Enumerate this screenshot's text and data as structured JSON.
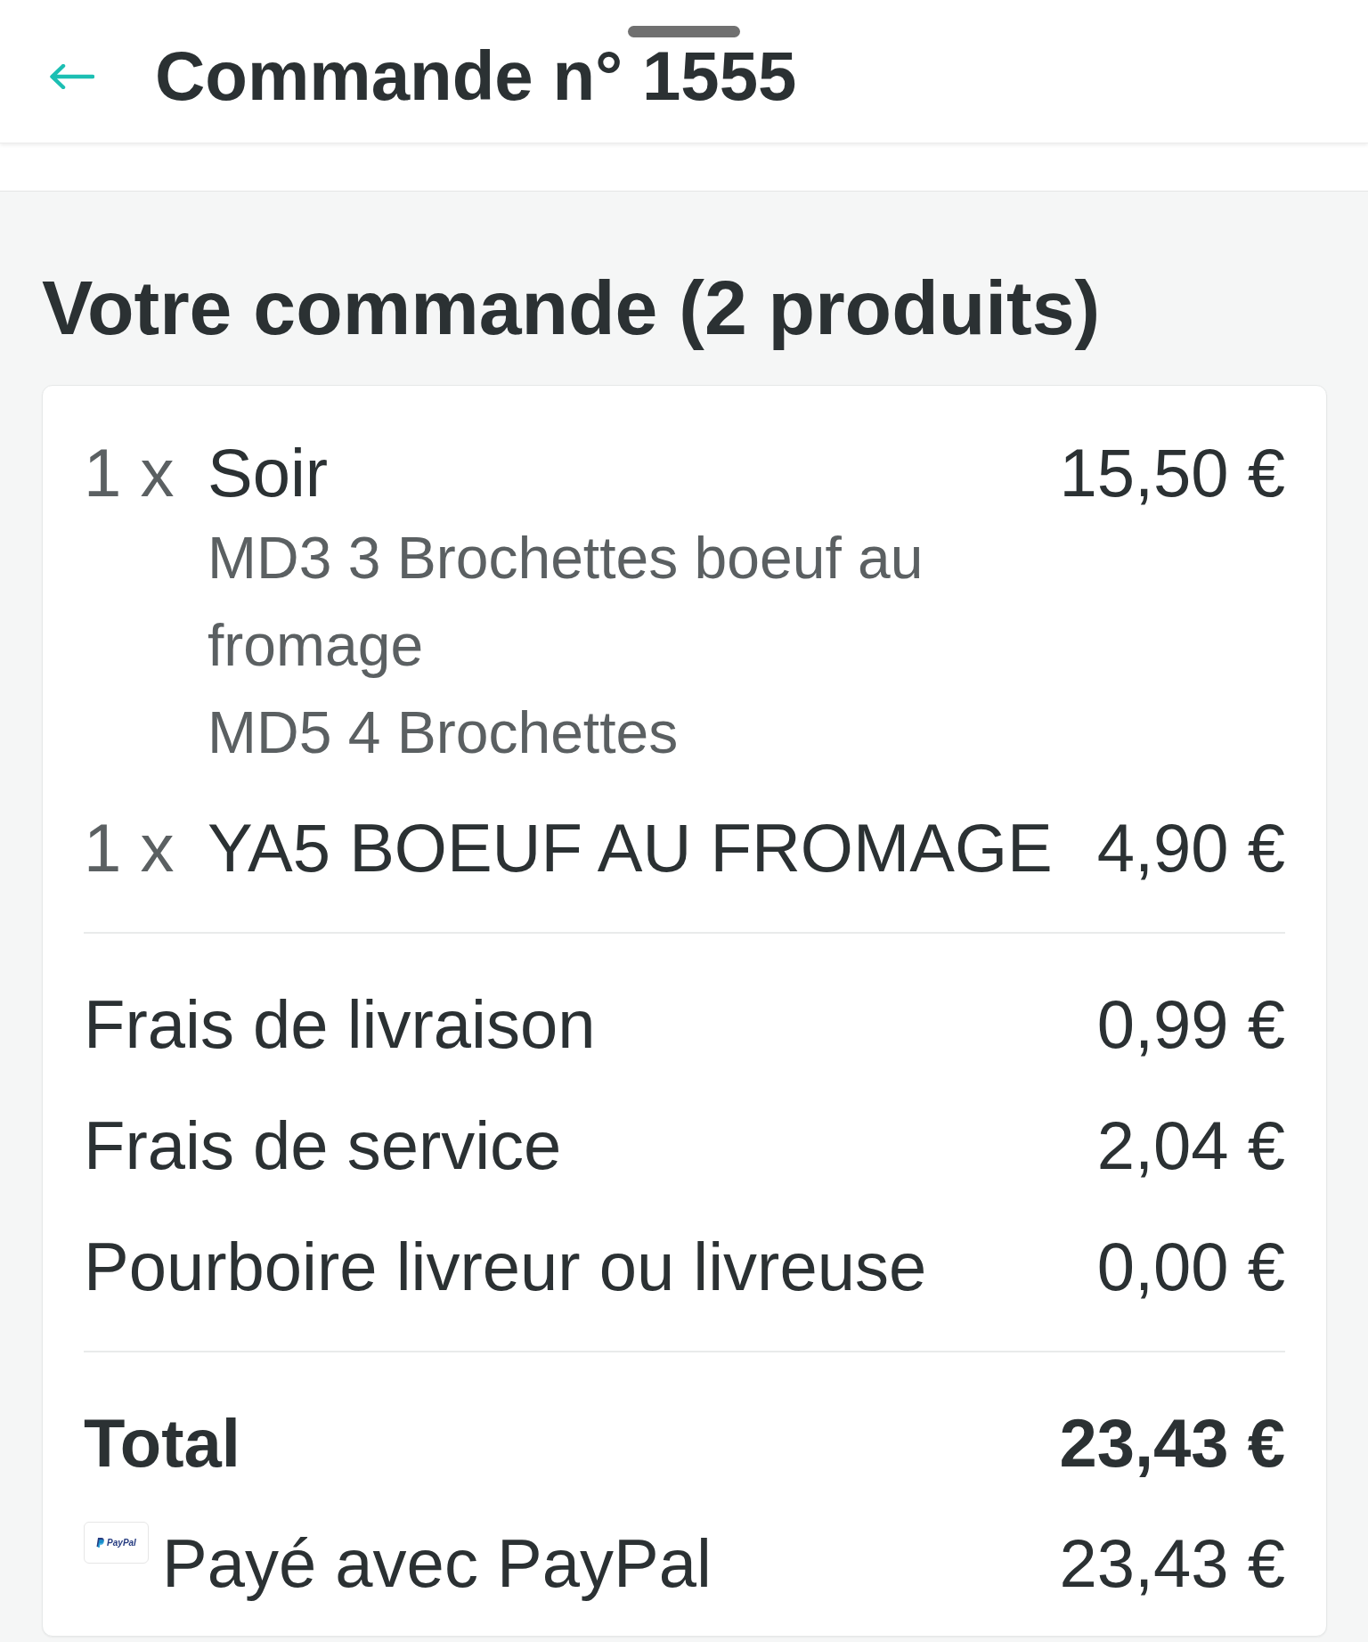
{
  "header": {
    "title": "Commande n° 1555"
  },
  "order": {
    "heading": "Votre commande (2 produits)",
    "items": [
      {
        "quantity": "1 x",
        "name": "Soir",
        "price": "15,50 €",
        "options": [
          "MD3 3 Brochettes boeuf au fromage",
          "MD5 4 Brochettes"
        ]
      },
      {
        "quantity": "1 x",
        "name": "YA5 BOEUF AU FROMAGE",
        "price": "4,90 €"
      }
    ],
    "fees": [
      {
        "label": "Frais de livraison",
        "amount": "0,99 €"
      },
      {
        "label": "Frais de service",
        "amount": "2,04 €"
      },
      {
        "label": "Pourboire livreur ou livreuse",
        "amount": "0,00 €"
      }
    ],
    "total": {
      "label": "Total",
      "amount": "23,43 €"
    },
    "payment": {
      "logo_text": "PayPal",
      "label": "Payé avec PayPal",
      "amount": "23,43 €"
    }
  }
}
